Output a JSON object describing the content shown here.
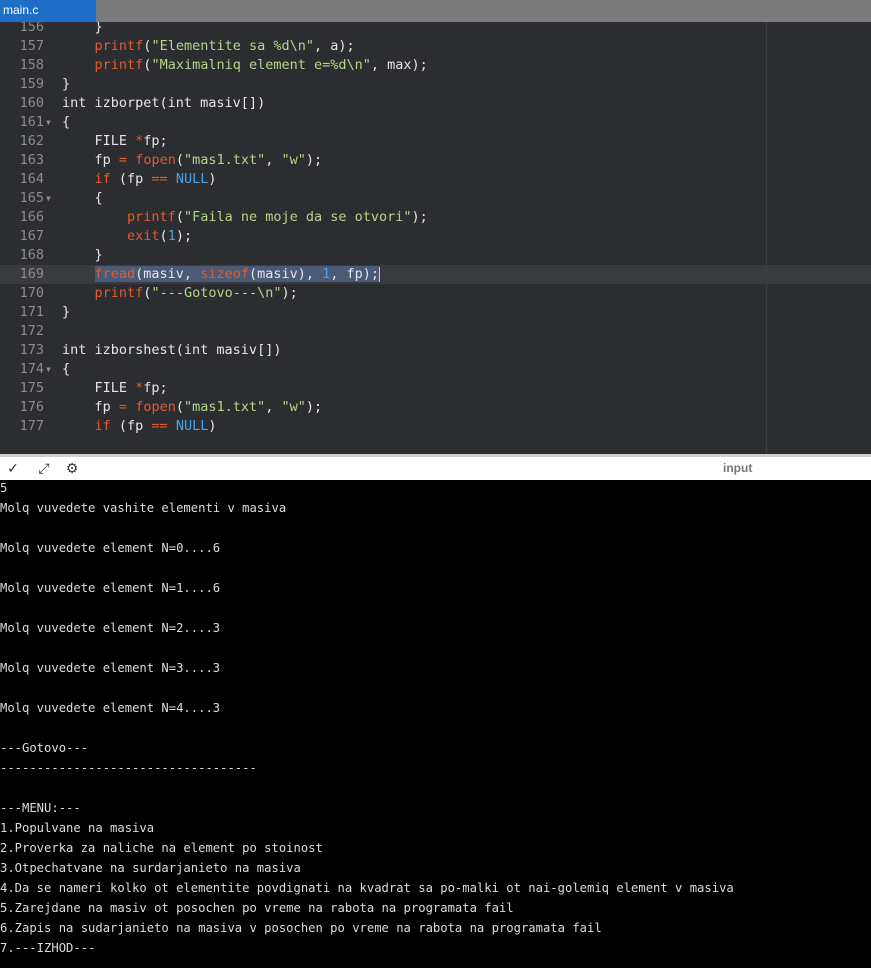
{
  "tab": {
    "filename": "main.c"
  },
  "editor": {
    "lines": [
      {
        "n": "156",
        "fold": "",
        "active": false,
        "tokens": [
          [
            "pl",
            "    }"
          ]
        ]
      },
      {
        "n": "157",
        "fold": "",
        "active": false,
        "tokens": [
          [
            "pl",
            "    "
          ],
          [
            "fn",
            "printf"
          ],
          [
            "pl",
            "("
          ],
          [
            "str",
            "\"Elementite sa %d\\n\""
          ],
          [
            "pl",
            ", a);"
          ]
        ]
      },
      {
        "n": "158",
        "fold": "",
        "active": false,
        "tokens": [
          [
            "pl",
            "    "
          ],
          [
            "fn",
            "printf"
          ],
          [
            "pl",
            "("
          ],
          [
            "str",
            "\"Maximalniq element e=%d\\n\""
          ],
          [
            "pl",
            ", max);"
          ]
        ]
      },
      {
        "n": "159",
        "fold": "",
        "active": false,
        "tokens": [
          [
            "pl",
            "}"
          ]
        ]
      },
      {
        "n": "160",
        "fold": "",
        "active": false,
        "tokens": [
          [
            "pl",
            "int izborpet(int masiv[])"
          ]
        ]
      },
      {
        "n": "161",
        "fold": "▼",
        "active": false,
        "tokens": [
          [
            "pl",
            "{"
          ]
        ]
      },
      {
        "n": "162",
        "fold": "",
        "active": false,
        "tokens": [
          [
            "pl",
            "    FILE "
          ],
          [
            "op",
            "*"
          ],
          [
            "pl",
            "fp;"
          ]
        ]
      },
      {
        "n": "163",
        "fold": "",
        "active": false,
        "tokens": [
          [
            "pl",
            "    fp "
          ],
          [
            "op",
            "="
          ],
          [
            "pl",
            " "
          ],
          [
            "fn",
            "fopen"
          ],
          [
            "pl",
            "("
          ],
          [
            "str",
            "\"mas1.txt\""
          ],
          [
            "pl",
            ", "
          ],
          [
            "str",
            "\"w\""
          ],
          [
            "pl",
            ");"
          ]
        ]
      },
      {
        "n": "164",
        "fold": "",
        "active": false,
        "tokens": [
          [
            "pl",
            "    "
          ],
          [
            "kw",
            "if"
          ],
          [
            "pl",
            " (fp "
          ],
          [
            "op",
            "=="
          ],
          [
            "pl",
            " "
          ],
          [
            "null",
            "NULL"
          ],
          [
            "pl",
            ")"
          ]
        ]
      },
      {
        "n": "165",
        "fold": "▼",
        "active": false,
        "tokens": [
          [
            "pl",
            "    {"
          ]
        ]
      },
      {
        "n": "166",
        "fold": "",
        "active": false,
        "tokens": [
          [
            "pl",
            "        "
          ],
          [
            "fn",
            "printf"
          ],
          [
            "pl",
            "("
          ],
          [
            "str",
            "\"Faila ne moje da se otvori\""
          ],
          [
            "pl",
            ");"
          ]
        ]
      },
      {
        "n": "167",
        "fold": "",
        "active": false,
        "tokens": [
          [
            "pl",
            "        "
          ],
          [
            "fn",
            "exit"
          ],
          [
            "pl",
            "("
          ],
          [
            "num",
            "1"
          ],
          [
            "pl",
            ");"
          ]
        ]
      },
      {
        "n": "168",
        "fold": "",
        "active": false,
        "tokens": [
          [
            "pl",
            "    }"
          ]
        ]
      },
      {
        "n": "169",
        "fold": "",
        "active": true,
        "tokens": [
          [
            "pl",
            "    "
          ],
          [
            "selfn",
            "fread"
          ],
          [
            "sel",
            "(masiv, "
          ],
          [
            "selfn",
            "sizeof"
          ],
          [
            "sel",
            "(masiv), "
          ],
          [
            "selnum",
            "1"
          ],
          [
            "sel",
            ", fp);"
          ],
          [
            "cur",
            ""
          ]
        ]
      },
      {
        "n": "170",
        "fold": "",
        "active": false,
        "tokens": [
          [
            "pl",
            "    "
          ],
          [
            "fn",
            "printf"
          ],
          [
            "pl",
            "("
          ],
          [
            "str",
            "\"---Gotovo---\\n\""
          ],
          [
            "pl",
            ");"
          ]
        ]
      },
      {
        "n": "171",
        "fold": "",
        "active": false,
        "tokens": [
          [
            "pl",
            "}"
          ]
        ]
      },
      {
        "n": "172",
        "fold": "",
        "active": false,
        "tokens": [
          [
            "pl",
            ""
          ]
        ]
      },
      {
        "n": "173",
        "fold": "",
        "active": false,
        "tokens": [
          [
            "pl",
            "int izborshest(int masiv[])"
          ]
        ]
      },
      {
        "n": "174",
        "fold": "▼",
        "active": false,
        "tokens": [
          [
            "pl",
            "{"
          ]
        ]
      },
      {
        "n": "175",
        "fold": "",
        "active": false,
        "tokens": [
          [
            "pl",
            "    FILE "
          ],
          [
            "op",
            "*"
          ],
          [
            "pl",
            "fp;"
          ]
        ]
      },
      {
        "n": "176",
        "fold": "",
        "active": false,
        "tokens": [
          [
            "pl",
            "    fp "
          ],
          [
            "op",
            "="
          ],
          [
            "pl",
            " "
          ],
          [
            "fn",
            "fopen"
          ],
          [
            "pl",
            "("
          ],
          [
            "str",
            "\"mas1.txt\""
          ],
          [
            "pl",
            ", "
          ],
          [
            "str",
            "\"w\""
          ],
          [
            "pl",
            ");"
          ]
        ]
      },
      {
        "n": "177",
        "fold": "",
        "active": false,
        "tokens": [
          [
            "pl",
            "    "
          ],
          [
            "kw",
            "if"
          ],
          [
            "pl",
            " (fp "
          ],
          [
            "op",
            "=="
          ],
          [
            "pl",
            " "
          ],
          [
            "null",
            "NULL"
          ],
          [
            "pl",
            ")"
          ]
        ]
      }
    ]
  },
  "toolbar": {
    "collapse_icon": "chevron-down-icon",
    "expand_icon": "expand-arrows-icon",
    "clear_icon": "pin-icon",
    "input_label": "input"
  },
  "console": {
    "lines": [
      "5",
      "Molq vuvedete vashite elementi v masiva",
      "",
      "Molq vuvedete element N=0....6",
      "",
      "Molq vuvedete element N=1....6",
      "",
      "Molq vuvedete element N=2....3",
      "",
      "Molq vuvedete element N=3....3",
      "",
      "Molq vuvedete element N=4....3",
      "",
      "---Gotovo---",
      "-----------------------------------",
      "",
      "---MENU:---",
      "1.Populvane na masiva",
      "2.Proverka za naliche na element po stoinost",
      "3.Otpechatvane na surdarjanieto na masiva",
      "4.Da se nameri kolko ot elementite povdignati na kvadrat sa po-malki ot nai-golemiq element v masiva",
      "5.Zarejdane na masiv ot posochen po vreme na rabota na programata fail",
      "6.Zapis na sudarjanieto na masiva v posochen po vreme na rabota na programata fail",
      "7.---IZHOD---"
    ]
  },
  "colors": {
    "tab_active": "#1e6ec8",
    "editor_bg": "#2c2d30",
    "function": "#e35a2c",
    "string": "#b5d68a",
    "number": "#4aa3e8",
    "console_bg": "#000000"
  }
}
